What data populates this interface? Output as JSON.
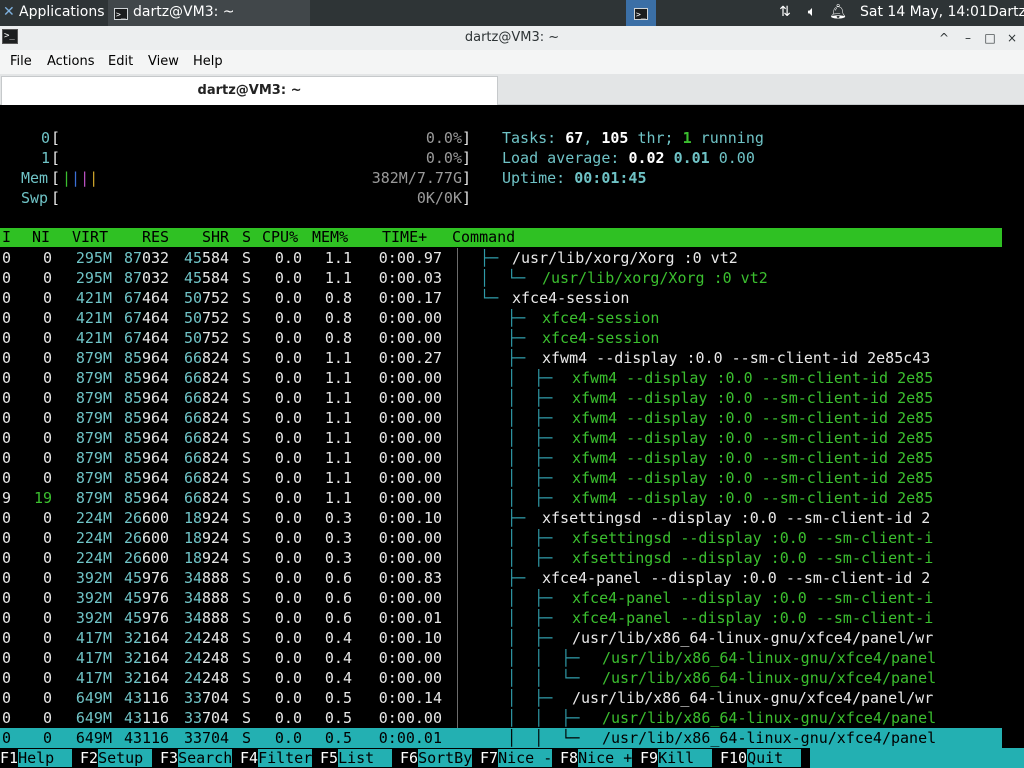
{
  "panel": {
    "applications_label": "Applications",
    "task_title": "dartz@VM3: ~",
    "clock": "Sat 14 May, 14:01",
    "user": "Dartz",
    "icons": [
      "terminal-icon",
      "network-icon",
      "volume-icon",
      "notification-bell-icon"
    ]
  },
  "window": {
    "title": "dartz@VM3: ~",
    "controls": [
      "^",
      "–",
      "□",
      "×"
    ]
  },
  "menu": {
    "file": "File",
    "actions": "Actions",
    "edit": "Edit",
    "view": "View",
    "help": "Help"
  },
  "tab": {
    "label": "dartz@VM3: ~"
  },
  "meters": {
    "cpu0_label": "0",
    "cpu0_val": "0.0%",
    "cpu1_label": "1",
    "cpu1_val": "0.0%",
    "mem_label": "Mem",
    "mem_bar": "||||",
    "mem_val": "382M/7.77G",
    "swp_label": "Swp",
    "swp_val": "0K/0K"
  },
  "summary": {
    "tasks_label": "Tasks: ",
    "tasks": "67",
    "thr_sep": ", ",
    "thr": "105",
    "thr_label": " thr; ",
    "running": "1",
    "running_label": " running",
    "load_label": "Load average: ",
    "load1": "0.02",
    "load5": "0.01",
    "load15": "0.00",
    "uptime_label": "Uptime: ",
    "uptime": "00:01:45"
  },
  "columns": {
    "pri": "I",
    "ni": "NI",
    "virt": "VIRT",
    "res": "RES",
    "shr": "SHR",
    "s": "S",
    "cpu": "CPU%",
    "mem": "MEM%",
    "time": "TIME+",
    "cmd": "Command"
  },
  "processes": [
    {
      "pri": "0",
      "ni": "0",
      "virt": "295M",
      "res_a": "87",
      "res_b": "032",
      "shr_a": "45",
      "shr_b": "584",
      "s": "S",
      "cpu": "0.0",
      "mem": "1.1",
      "time": "0:00.97",
      "tree": "  ├─ ",
      "cmd": "/usr/lib/xorg/Xorg :0 vt2",
      "thread": false
    },
    {
      "pri": "0",
      "ni": "0",
      "virt": "295M",
      "res_a": "87",
      "res_b": "032",
      "shr_a": "45",
      "shr_b": "584",
      "s": "S",
      "cpu": "0.0",
      "mem": "1.1",
      "time": "0:00.03",
      "tree": "  │  └─ ",
      "cmd": "/usr/lib/xorg/Xorg :0 vt2",
      "thread": true
    },
    {
      "pri": "0",
      "ni": "0",
      "virt": "421M",
      "res_a": "67",
      "res_b": "464",
      "shr_a": "50",
      "shr_b": "752",
      "s": "S",
      "cpu": "0.0",
      "mem": "0.8",
      "time": "0:00.17",
      "tree": "  └─ ",
      "cmd": "xfce4-session",
      "thread": false
    },
    {
      "pri": "0",
      "ni": "0",
      "virt": "421M",
      "res_a": "67",
      "res_b": "464",
      "shr_a": "50",
      "shr_b": "752",
      "s": "S",
      "cpu": "0.0",
      "mem": "0.8",
      "time": "0:00.00",
      "tree": "     ├─ ",
      "cmd": "xfce4-session",
      "thread": true
    },
    {
      "pri": "0",
      "ni": "0",
      "virt": "421M",
      "res_a": "67",
      "res_b": "464",
      "shr_a": "50",
      "shr_b": "752",
      "s": "S",
      "cpu": "0.0",
      "mem": "0.8",
      "time": "0:00.00",
      "tree": "     ├─ ",
      "cmd": "xfce4-session",
      "thread": true
    },
    {
      "pri": "0",
      "ni": "0",
      "virt": "879M",
      "res_a": "85",
      "res_b": "964",
      "shr_a": "66",
      "shr_b": "824",
      "s": "S",
      "cpu": "0.0",
      "mem": "1.1",
      "time": "0:00.27",
      "tree": "     ├─ ",
      "cmd": "xfwm4 --display :0.0 --sm-client-id 2e85c43",
      "thread": false
    },
    {
      "pri": "0",
      "ni": "0",
      "virt": "879M",
      "res_a": "85",
      "res_b": "964",
      "shr_a": "66",
      "shr_b": "824",
      "s": "S",
      "cpu": "0.0",
      "mem": "1.1",
      "time": "0:00.00",
      "tree": "     │  ├─ ",
      "cmd": "xfwm4 --display :0.0 --sm-client-id 2e85",
      "thread": true
    },
    {
      "pri": "0",
      "ni": "0",
      "virt": "879M",
      "res_a": "85",
      "res_b": "964",
      "shr_a": "66",
      "shr_b": "824",
      "s": "S",
      "cpu": "0.0",
      "mem": "1.1",
      "time": "0:00.00",
      "tree": "     │  ├─ ",
      "cmd": "xfwm4 --display :0.0 --sm-client-id 2e85",
      "thread": true
    },
    {
      "pri": "0",
      "ni": "0",
      "virt": "879M",
      "res_a": "85",
      "res_b": "964",
      "shr_a": "66",
      "shr_b": "824",
      "s": "S",
      "cpu": "0.0",
      "mem": "1.1",
      "time": "0:00.00",
      "tree": "     │  ├─ ",
      "cmd": "xfwm4 --display :0.0 --sm-client-id 2e85",
      "thread": true
    },
    {
      "pri": "0",
      "ni": "0",
      "virt": "879M",
      "res_a": "85",
      "res_b": "964",
      "shr_a": "66",
      "shr_b": "824",
      "s": "S",
      "cpu": "0.0",
      "mem": "1.1",
      "time": "0:00.00",
      "tree": "     │  ├─ ",
      "cmd": "xfwm4 --display :0.0 --sm-client-id 2e85",
      "thread": true
    },
    {
      "pri": "0",
      "ni": "0",
      "virt": "879M",
      "res_a": "85",
      "res_b": "964",
      "shr_a": "66",
      "shr_b": "824",
      "s": "S",
      "cpu": "0.0",
      "mem": "1.1",
      "time": "0:00.00",
      "tree": "     │  ├─ ",
      "cmd": "xfwm4 --display :0.0 --sm-client-id 2e85",
      "thread": true
    },
    {
      "pri": "0",
      "ni": "0",
      "virt": "879M",
      "res_a": "85",
      "res_b": "964",
      "shr_a": "66",
      "shr_b": "824",
      "s": "S",
      "cpu": "0.0",
      "mem": "1.1",
      "time": "0:00.00",
      "tree": "     │  ├─ ",
      "cmd": "xfwm4 --display :0.0 --sm-client-id 2e85",
      "thread": true
    },
    {
      "pri": "9",
      "ni": "19",
      "virt": "879M",
      "res_a": "85",
      "res_b": "964",
      "shr_a": "66",
      "shr_b": "824",
      "s": "S",
      "cpu": "0.0",
      "mem": "1.1",
      "time": "0:00.00",
      "tree": "     │  ├─ ",
      "cmd": "xfwm4 --display :0.0 --sm-client-id 2e85",
      "thread": true
    },
    {
      "pri": "0",
      "ni": "0",
      "virt": "224M",
      "res_a": "26",
      "res_b": "600",
      "shr_a": "18",
      "shr_b": "924",
      "s": "S",
      "cpu": "0.0",
      "mem": "0.3",
      "time": "0:00.10",
      "tree": "     ├─ ",
      "cmd": "xfsettingsd --display :0.0 --sm-client-id 2",
      "thread": false
    },
    {
      "pri": "0",
      "ni": "0",
      "virt": "224M",
      "res_a": "26",
      "res_b": "600",
      "shr_a": "18",
      "shr_b": "924",
      "s": "S",
      "cpu": "0.0",
      "mem": "0.3",
      "time": "0:00.00",
      "tree": "     │  ├─ ",
      "cmd": "xfsettingsd --display :0.0 --sm-client-i",
      "thread": true
    },
    {
      "pri": "0",
      "ni": "0",
      "virt": "224M",
      "res_a": "26",
      "res_b": "600",
      "shr_a": "18",
      "shr_b": "924",
      "s": "S",
      "cpu": "0.0",
      "mem": "0.3",
      "time": "0:00.00",
      "tree": "     │  ├─ ",
      "cmd": "xfsettingsd --display :0.0 --sm-client-i",
      "thread": true
    },
    {
      "pri": "0",
      "ni": "0",
      "virt": "392M",
      "res_a": "45",
      "res_b": "976",
      "shr_a": "34",
      "shr_b": "888",
      "s": "S",
      "cpu": "0.0",
      "mem": "0.6",
      "time": "0:00.83",
      "tree": "     ├─ ",
      "cmd": "xfce4-panel --display :0.0 --sm-client-id 2",
      "thread": false
    },
    {
      "pri": "0",
      "ni": "0",
      "virt": "392M",
      "res_a": "45",
      "res_b": "976",
      "shr_a": "34",
      "shr_b": "888",
      "s": "S",
      "cpu": "0.0",
      "mem": "0.6",
      "time": "0:00.00",
      "tree": "     │  ├─ ",
      "cmd": "xfce4-panel --display :0.0 --sm-client-i",
      "thread": true
    },
    {
      "pri": "0",
      "ni": "0",
      "virt": "392M",
      "res_a": "45",
      "res_b": "976",
      "shr_a": "34",
      "shr_b": "888",
      "s": "S",
      "cpu": "0.0",
      "mem": "0.6",
      "time": "0:00.01",
      "tree": "     │  ├─ ",
      "cmd": "xfce4-panel --display :0.0 --sm-client-i",
      "thread": true
    },
    {
      "pri": "0",
      "ni": "0",
      "virt": "417M",
      "res_a": "32",
      "res_b": "164",
      "shr_a": "24",
      "shr_b": "248",
      "s": "S",
      "cpu": "0.0",
      "mem": "0.4",
      "time": "0:00.10",
      "tree": "     │  ├─ ",
      "cmd": "/usr/lib/x86_64-linux-gnu/xfce4/panel/wr",
      "thread": false
    },
    {
      "pri": "0",
      "ni": "0",
      "virt": "417M",
      "res_a": "32",
      "res_b": "164",
      "shr_a": "24",
      "shr_b": "248",
      "s": "S",
      "cpu": "0.0",
      "mem": "0.4",
      "time": "0:00.00",
      "tree": "     │  │  ├─ ",
      "cmd": "/usr/lib/x86_64-linux-gnu/xfce4/panel",
      "thread": true
    },
    {
      "pri": "0",
      "ni": "0",
      "virt": "417M",
      "res_a": "32",
      "res_b": "164",
      "shr_a": "24",
      "shr_b": "248",
      "s": "S",
      "cpu": "0.0",
      "mem": "0.4",
      "time": "0:00.00",
      "tree": "     │  │  └─ ",
      "cmd": "/usr/lib/x86_64-linux-gnu/xfce4/panel",
      "thread": true
    },
    {
      "pri": "0",
      "ni": "0",
      "virt": "649M",
      "res_a": "43",
      "res_b": "116",
      "shr_a": "33",
      "shr_b": "704",
      "s": "S",
      "cpu": "0.0",
      "mem": "0.5",
      "time": "0:00.14",
      "tree": "     │  ├─ ",
      "cmd": "/usr/lib/x86_64-linux-gnu/xfce4/panel/wr",
      "thread": false
    },
    {
      "pri": "0",
      "ni": "0",
      "virt": "649M",
      "res_a": "43",
      "res_b": "116",
      "shr_a": "33",
      "shr_b": "704",
      "s": "S",
      "cpu": "0.0",
      "mem": "0.5",
      "time": "0:00.00",
      "tree": "     │  │  ├─ ",
      "cmd": "/usr/lib/x86_64-linux-gnu/xfce4/panel",
      "thread": true
    },
    {
      "pri": "0",
      "ni": "0",
      "virt": "649M",
      "res_a": "43",
      "res_b": "116",
      "shr_a": "33",
      "shr_b": "704",
      "s": "S",
      "cpu": "0.0",
      "mem": "0.5",
      "time": "0:00.01",
      "tree": "     │  │  └─ ",
      "cmd": "/usr/lib/x86_64-linux-gnu/xfce4/panel",
      "thread": true,
      "selected": true
    }
  ],
  "fkeys": [
    {
      "key": "F1",
      "label": "Help  "
    },
    {
      "key": "F2",
      "label": "Setup "
    },
    {
      "key": "F3",
      "label": "Search"
    },
    {
      "key": "F4",
      "label": "Filter"
    },
    {
      "key": "F5",
      "label": "List  "
    },
    {
      "key": "F6",
      "label": "SortBy"
    },
    {
      "key": "F7",
      "label": "Nice -"
    },
    {
      "key": "F8",
      "label": "Nice +"
    },
    {
      "key": "F9",
      "label": "Kill  "
    },
    {
      "key": "F10",
      "label": "Quit  "
    }
  ]
}
